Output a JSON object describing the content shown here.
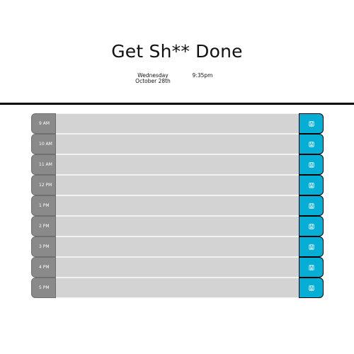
{
  "header": {
    "title": "Get Sh** Done",
    "date_weekday": "Wednesday",
    "date_day": "October 28th",
    "time": "9:35pm"
  },
  "colors": {
    "hour_block": "#8a8a8a",
    "task_block": "#d3d3d3",
    "save_button": "#06aed5"
  },
  "planner": {
    "rows": [
      {
        "hour": "9 AM",
        "task": "",
        "icon": "save-icon"
      },
      {
        "hour": "10 AM",
        "task": "",
        "icon": "save-icon"
      },
      {
        "hour": "11 AM",
        "task": "",
        "icon": "save-icon"
      },
      {
        "hour": "12 PM",
        "task": "",
        "icon": "save-icon"
      },
      {
        "hour": "1 PM",
        "task": "",
        "icon": "save-icon"
      },
      {
        "hour": "2 PM",
        "task": "",
        "icon": "save-icon"
      },
      {
        "hour": "3 PM",
        "task": "",
        "icon": "save-icon"
      },
      {
        "hour": "4 PM",
        "task": "",
        "icon": "save-icon"
      },
      {
        "hour": "5 PM",
        "task": "",
        "icon": "save-icon"
      }
    ]
  }
}
